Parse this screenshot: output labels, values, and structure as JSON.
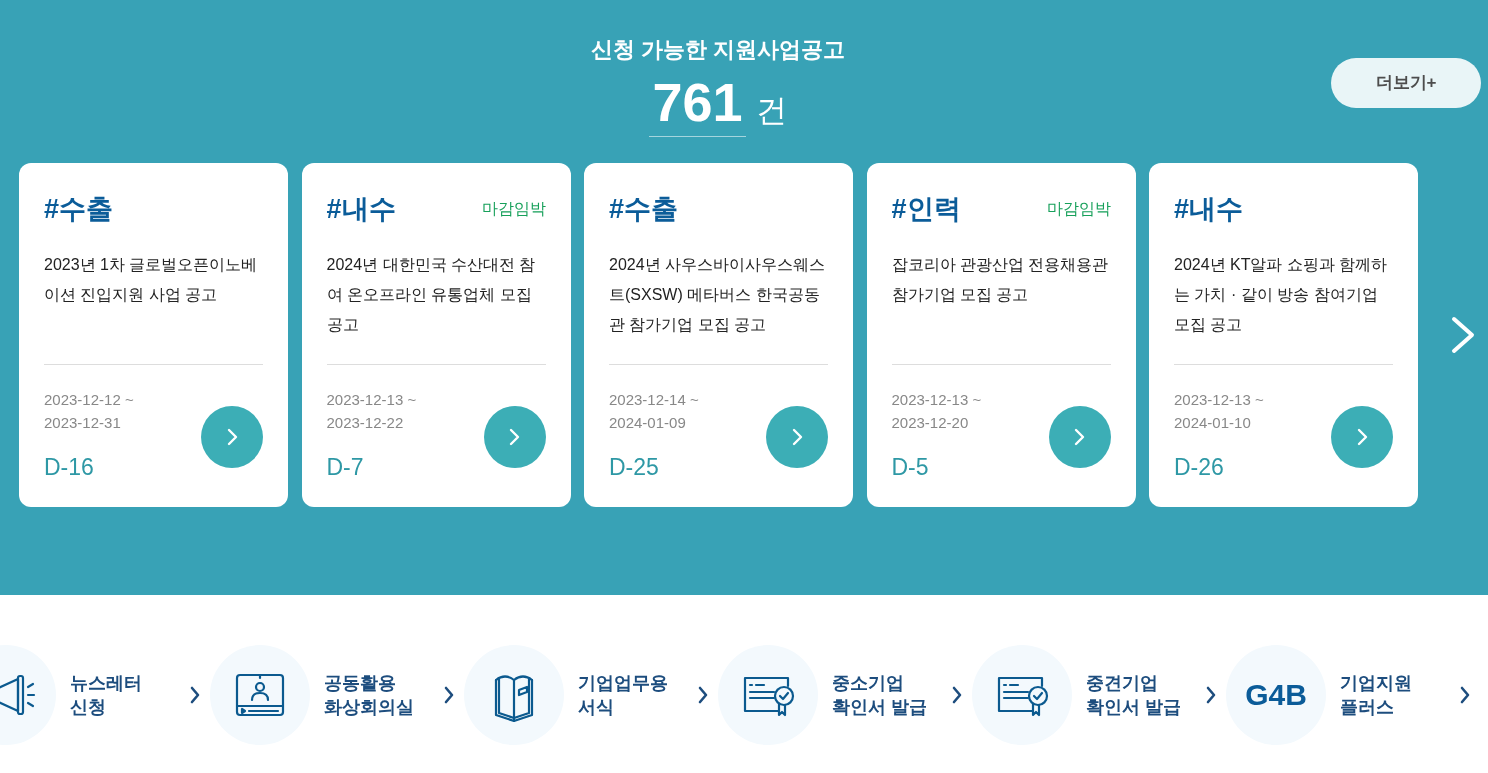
{
  "header": {
    "title": "신청 가능한 지원사업공고",
    "count": "761",
    "unit": "건",
    "more_button": "더보기+"
  },
  "cards": [
    {
      "tag": "#수출",
      "title": "2023년 1차 글로벌오픈이노베이션 진입지원 사업 공고",
      "period": "2023-12-12 ~ 2023-12-31",
      "dday": "D-16"
    },
    {
      "tag": "#내수",
      "badge": "마감임박",
      "title": "2024년 대한민국 수산대전 참여 온오프라인 유통업체 모집 공고",
      "period": "2023-12-13 ~ 2023-12-22",
      "dday": "D-7"
    },
    {
      "tag": "#수출",
      "title": "2024년 사우스바이사우스웨스트(SXSW) 메타버스 한국공동관 참가기업 모집 공고",
      "period": "2023-12-14 ~ 2024-01-09",
      "dday": "D-25"
    },
    {
      "tag": "#인력",
      "badge": "마감임박",
      "title": "잡코리아 관광산업 전용채용관 참가기업 모집 공고",
      "period": "2023-12-13 ~ 2023-12-20",
      "dday": "D-5"
    },
    {
      "tag": "#내수",
      "title": "2024년 KT알파 쇼핑과 함께하는 가치 · 같이 방송 참여기업 모집 공고",
      "period": "2023-12-13 ~ 2024-01-10",
      "dday": "D-26"
    }
  ],
  "quick_links": [
    {
      "kind": "megaphone",
      "label": "뉴스레터 신청"
    },
    {
      "kind": "video",
      "label": "공동활용 화상회의실"
    },
    {
      "kind": "book",
      "label": "기업업무용 서식"
    },
    {
      "kind": "certificate",
      "label": "중소기업 확인서 발급"
    },
    {
      "kind": "certificate",
      "label": "중견기업 확인서 발급"
    },
    {
      "kind": "text",
      "logo": "G4B",
      "label": "기업지원 플러스"
    }
  ]
}
